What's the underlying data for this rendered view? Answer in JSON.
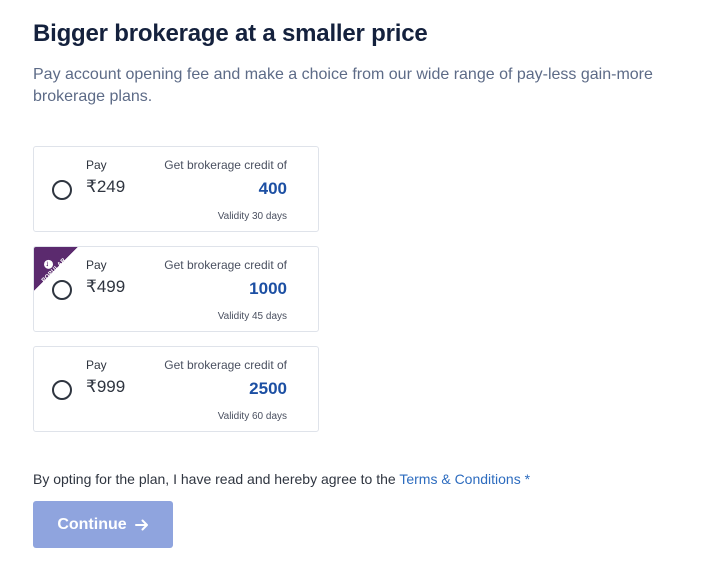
{
  "header": {
    "title": "Bigger brokerage at a smaller price",
    "subtitle": "Pay account opening fee and make a choice from our wide range of pay-less gain-more brokerage plans."
  },
  "plans": [
    {
      "pay_label": "Pay",
      "price": "₹249",
      "credit_label": "Get brokerage credit of",
      "credit": "400",
      "validity": "Validity 30 days",
      "selected": false,
      "badge": null
    },
    {
      "pay_label": "Pay",
      "price": "₹499",
      "credit_label": "Get brokerage credit of",
      "credit": "1000",
      "validity": "Validity 45 days",
      "selected": false,
      "badge": "POPULAR"
    },
    {
      "pay_label": "Pay",
      "price": "₹999",
      "credit_label": "Get brokerage credit of",
      "credit": "2500",
      "validity": "Validity 60 days",
      "selected": false,
      "badge": null
    }
  ],
  "agreement": {
    "text": "By opting for the plan, I have read and hereby agree to the ",
    "link_label": "Terms & Conditions",
    "required_marker": "*"
  },
  "continue_button": {
    "label": "Continue",
    "icon": "arrow-right-icon"
  },
  "colors": {
    "title": "#14213d",
    "credit_value": "#1c4fa3",
    "link": "#2d6cbf",
    "button_bg": "#8fa4de",
    "badge_bg": "#5b2a6e"
  }
}
